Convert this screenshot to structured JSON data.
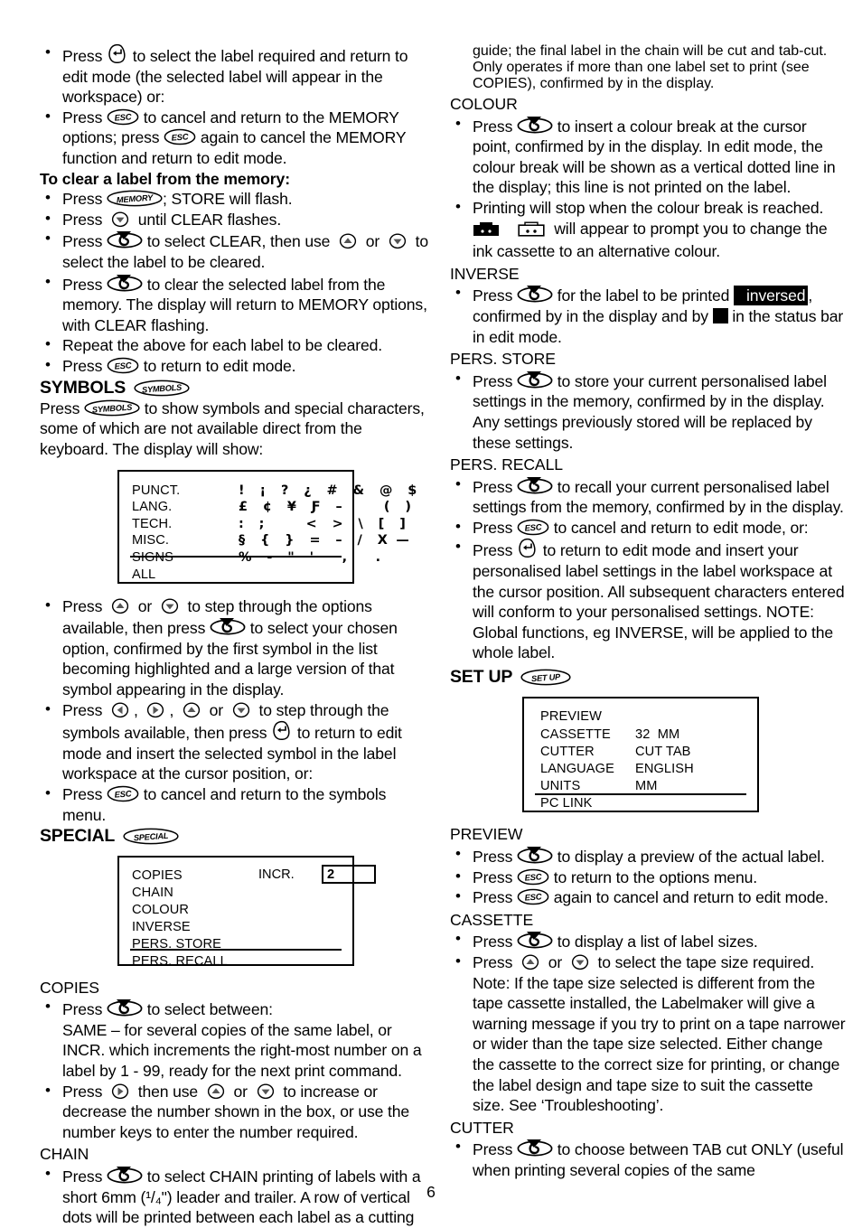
{
  "page": {
    "number": "6"
  },
  "left": {
    "b1": "Press {ENTER} to select the label required and return to edit mode (the selected label will appear in the workspace) or:",
    "b2": "Press {ESC} to cancel and return to the MEMORY options; press {ESC} again to cancel the MEMORY function and return to edit mode.",
    "clear_heading": "To clear a label from the memory:",
    "b3": "Press {MEMORY}; STORE will flash.",
    "b4": "Press {DOWN} until CLEAR flashes.",
    "b5": "Press {SELECT} to select CLEAR, then use {UP} or {DOWN} to select the label to be cleared.",
    "b6": "Press {SELECT} to clear the selected label from the memory. The display will return to MEMORY options, with CLEAR flashing.",
    "b7": "Repeat the above for each label to be cleared.",
    "b8": "Press {ESC} to return to edit mode.",
    "symbols_title": "SYMBOLS",
    "symbols_key": "SYMBOLS",
    "symbols_intro": "Press {SYMBOLS} to show symbols and special characters, some of which are not available direct from the keyboard. The display will show:",
    "symbols_display": {
      "rows": [
        {
          "label": "PUNCT.",
          "symbols": "!  ¡  ?  ¿  #  &  @  $"
        },
        {
          "label": "LANG.",
          "symbols": "£  ¢  ¥  Ƒ  –      (  )"
        },
        {
          "label": "TECH.",
          "symbols": ":  ;      <  >  \\  [  ]"
        },
        {
          "label": "MISC.",
          "symbols": "§  {  }  =  –  /  X —"
        },
        {
          "label": "SIGNS",
          "symbols": "%  -  \"  '    ,    ."
        },
        {
          "label": "ALL",
          "symbols": ""
        }
      ]
    },
    "b9": "Press {UP} or {DOWN} to step through the options available, then press {SELECT} to select your chosen option, confirmed by the first symbol in the list becoming highlighted and a large version of that symbol appearing in the display.",
    "b10": "Press {LEFT}, {RIGHT}, {UP} or {DOWN} to step through the symbols available, then press {ENTER} to return to edit mode and insert the selected symbol in the label workspace at the cursor position, or:",
    "b11": "Press {ESC} to cancel and return to the symbols menu.",
    "special_title": "SPECIAL",
    "special_key": "SPECIAL",
    "special_display": {
      "items": [
        "COPIES",
        "CHAIN",
        "COLOUR",
        "INVERSE",
        "PERS. STORE",
        "PERS. RECALL"
      ],
      "incr_label": "INCR.",
      "incr_value": "2"
    },
    "copies_title": "COPIES",
    "b12": "Press {SELECT} to select between:",
    "b12_cont1": "SAME – for several copies of the same label, or",
    "b12_cont2": "INCR. which increments the right-most number on a label by 1 - 99, ready for the next print command.",
    "b13": "Press {RIGHT} then use {UP} or {DOWN} to increase or decrease the number shown in the box, or use the number keys to enter the number required.",
    "chain_title": "CHAIN",
    "b14": "Press {SELECT} to select CHAIN printing of labels with a short 6mm (¹/₄\") leader and trailer. A row of vertical dots will be printed between each label as a cutting"
  },
  "right": {
    "chain_cont": "guide; the final label in the chain will be cut and tab-cut. Only operates if more than one label set to print (see COPIES), confirmed by      in the display.",
    "colour_title": "COLOUR",
    "r1": "Press {SELECT} to insert a colour break at the cursor point, confirmed by      in the display. In edit mode, the colour break will be shown as a vertical dotted line in the display; this line is not printed on the label.",
    "r2a": "Printing will stop when the colour break is reached.",
    "r2b": "will appear to prompt you to change the ink cassette to an alternative colour.",
    "inverse_title": "INVERSE",
    "r3a": "Press {SELECT} for the label to be printed",
    "r3_inverse_word": "inversed",
    "r3b": ", confirmed by      in the display and by",
    "r3c": "in the status bar in edit mode.",
    "pers_store_title": "PERS. STORE",
    "r4": "Press {SELECT} to store your current personalised label settings in the memory, confirmed by      in the display. Any settings previously stored will be replaced by these settings.",
    "pers_recall_title": "PERS. RECALL",
    "r5": "Press {SELECT} to recall your current personalised label settings from the memory, confirmed by      in the display.",
    "r6": "Press {ESC} to cancel and return to edit mode, or:",
    "r7": "Press {ENTER} to return to edit mode and insert your personalised label settings in the label workspace at the cursor position. All subsequent characters entered will conform to your personalised settings. NOTE: Global functions, eg INVERSE, will be applied to the whole label.",
    "setup_title": "SET UP",
    "setup_key": "SET UP",
    "setup_display": {
      "rows": [
        {
          "label": "PREVIEW",
          "value": ""
        },
        {
          "label": "CASSETTE",
          "value": "32  MM"
        },
        {
          "label": "CUTTER",
          "value": "CUT TAB"
        },
        {
          "label": "LANGUAGE",
          "value": "ENGLISH"
        },
        {
          "label": "UNITS",
          "value": "MM"
        },
        {
          "label": "PC LINK",
          "value": ""
        }
      ]
    },
    "preview_title": "PREVIEW",
    "r8": "Press {SELECT} to display a preview of the actual label.",
    "r9": "Press {ESC} to return to the options menu.",
    "r10": "Press {ESC} again to cancel and return to edit mode.",
    "cassette_title": "CASSETTE",
    "r11": "Press {SELECT} to display a list of label sizes.",
    "r12": "Press {UP} or {DOWN} to select the tape size required.",
    "r12_note": "Note: If the tape size selected is different from the tape cassette installed, the Labelmaker will give a warning message if you try to print on a tape narrower or wider than the tape size selected. Either change the cassette to the correct size for printing, or change the label design and tape size to suit the cassette size. See ‘Troubleshooting’.",
    "cutter_title": "CUTTER",
    "r13": "Press {SELECT} to choose between TAB cut ONLY (useful when printing several copies of the same"
  },
  "keys": {
    "enter": "enter-key",
    "esc": "ESC",
    "memory": "MEMORY",
    "symbols": "SYMBOLS",
    "special": "SPECIAL",
    "setup": "SET UP",
    "select": "select-key",
    "up": "up-arrow-key",
    "down": "down-arrow-key",
    "left": "left-arrow-key",
    "right": "right-arrow-key"
  },
  "colors": {
    "ink": "#000000",
    "paper": "#ffffff"
  }
}
